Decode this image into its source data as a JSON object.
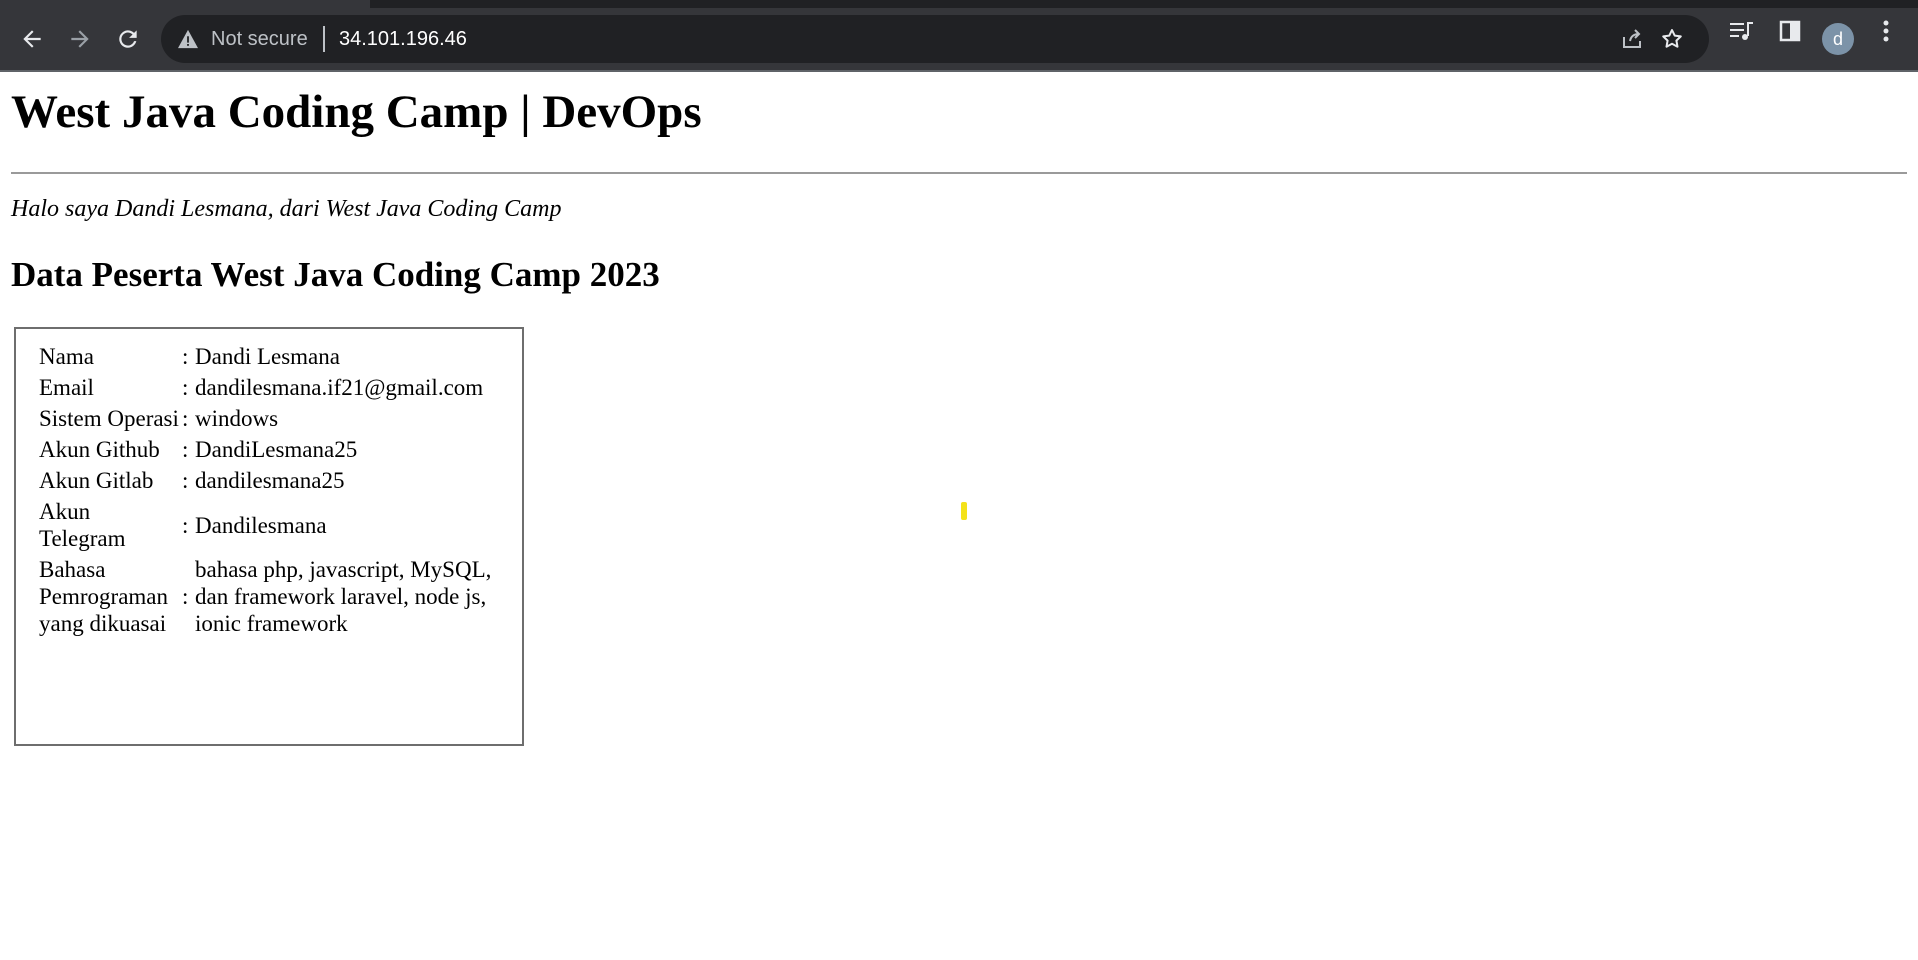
{
  "browser": {
    "security_label": "Not secure",
    "url": "34.101.196.46",
    "profile_initial": "d"
  },
  "page": {
    "title": "West Java Coding Camp | DevOps",
    "greeting": "Halo saya Dandi Lesmana, dari West Java Coding Camp",
    "section_title": "Data Peserta West Java Coding Camp 2023",
    "rows": [
      {
        "label": "Nama",
        "colon": ":",
        "value": "Dandi Lesmana"
      },
      {
        "label": "Email",
        "colon": ":",
        "value": "dandilesmana.if21@gmail.com"
      },
      {
        "label": "Sistem Operasi",
        "colon": ":",
        "value": "windows"
      },
      {
        "label": "Akun Github",
        "colon": ":",
        "value": "DandiLesmana25"
      },
      {
        "label": "Akun Gitlab",
        "colon": ":",
        "value": "dandilesmana25"
      },
      {
        "label": "Akun Telegram",
        "colon": ":",
        "value": "Dandilesmana"
      },
      {
        "label": "Bahasa Pemrograman yang dikuasai",
        "colon": ":",
        "value": "bahasa php, javascript, MySQL, dan framework laravel, node js, ionic framework"
      }
    ]
  }
}
